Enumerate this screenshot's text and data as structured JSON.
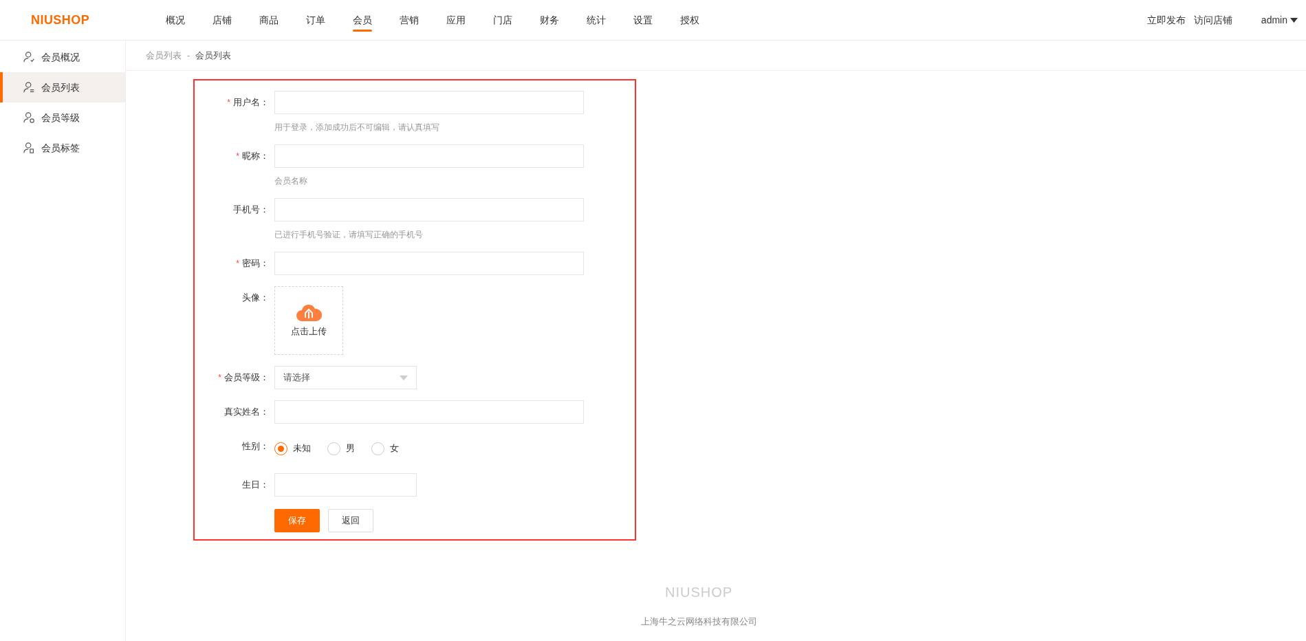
{
  "header": {
    "logo": "NIUSHOP",
    "nav": [
      {
        "label": "概况",
        "selected": false
      },
      {
        "label": "店铺",
        "selected": false
      },
      {
        "label": "商品",
        "selected": false
      },
      {
        "label": "订单",
        "selected": false
      },
      {
        "label": "会员",
        "selected": true
      },
      {
        "label": "营销",
        "selected": false
      },
      {
        "label": "应用",
        "selected": false
      },
      {
        "label": "门店",
        "selected": false
      },
      {
        "label": "财务",
        "selected": false
      },
      {
        "label": "统计",
        "selected": false
      },
      {
        "label": "设置",
        "selected": false
      },
      {
        "label": "授权",
        "selected": false
      }
    ],
    "actions": [
      "立即发布",
      "访问店铺"
    ],
    "user": "admin"
  },
  "sidebar": {
    "items": [
      {
        "label": "会员概况",
        "kind": "overview",
        "selected": false
      },
      {
        "label": "会员列表",
        "kind": "list",
        "selected": true
      },
      {
        "label": "会员等级",
        "kind": "level",
        "selected": false
      },
      {
        "label": "会员标签",
        "kind": "tag",
        "selected": false
      }
    ]
  },
  "breadcrumb": [
    "会员列表",
    "-",
    "会员列表"
  ],
  "form": {
    "fields": [
      {
        "kind": "text",
        "label": "用户名：",
        "required_mark": "*",
        "hint": "用于登录，添加成功后不可编辑，请认真填写"
      },
      {
        "kind": "text",
        "label": "昵称：",
        "required_mark": "*",
        "hint": "会员名称"
      },
      {
        "kind": "text",
        "label": "手机号：",
        "hint": "已进行手机号验证，请填写正确的手机号"
      },
      {
        "kind": "text",
        "label": "密码：",
        "required_mark": "*"
      },
      {
        "kind": "upload",
        "label": "头像：",
        "button": "点击上传"
      },
      {
        "kind": "select",
        "label": "会员等级：",
        "required_mark": "*",
        "placeholder": "请选择"
      },
      {
        "kind": "text",
        "label": "真实姓名："
      },
      {
        "kind": "radio",
        "label": "性别：",
        "options": [
          {
            "label": "未知",
            "selected": true
          },
          {
            "label": "男",
            "selected": false
          },
          {
            "label": "女",
            "selected": false
          }
        ]
      },
      {
        "kind": "date",
        "label": "生日："
      }
    ],
    "buttons": [
      {
        "label": "保存",
        "kind": "primary"
      },
      {
        "label": "返回",
        "kind": "secondary"
      }
    ]
  },
  "footer": {
    "logo": "NIUSHOP",
    "company": "上海牛之云网络科技有限公司"
  }
}
